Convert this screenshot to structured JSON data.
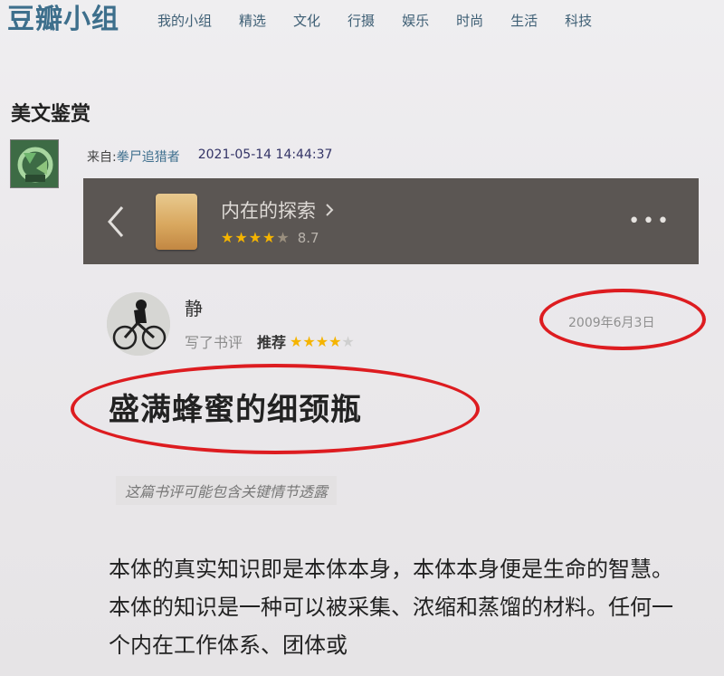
{
  "site": {
    "logo": "豆瓣小组",
    "nav": [
      "我的小组",
      "精选",
      "文化",
      "行摄",
      "娱乐",
      "时尚",
      "生活",
      "科技"
    ]
  },
  "group": {
    "title": "美文鉴赏",
    "from_label": "来自:",
    "author": "拳尸追猎者",
    "datetime": "2021-05-14 14:44:37"
  },
  "book": {
    "title": "内在的探索",
    "stars": "★★★★",
    "half_star": "★",
    "score": "8.7"
  },
  "review": {
    "username": "静",
    "wrote_label": "写了书评",
    "recommend_label": "推荐",
    "stars_on": "★★★★",
    "stars_off": "★",
    "date": "2009年6月3日",
    "title": "盛满蜂蜜的细颈瓶",
    "spoiler": "这篇书评可能包含关键情节透露",
    "body": "本体的真实知识即是本体本身，本体本身便是生命的智慧。本体的知识是一种可以被采集、浓缩和蒸馏的材料。任何一个内在工作体系、团体或"
  },
  "colors": {
    "annotation": "#dd1c20",
    "star": "#f5b400",
    "logo": "#3d6f8c"
  }
}
